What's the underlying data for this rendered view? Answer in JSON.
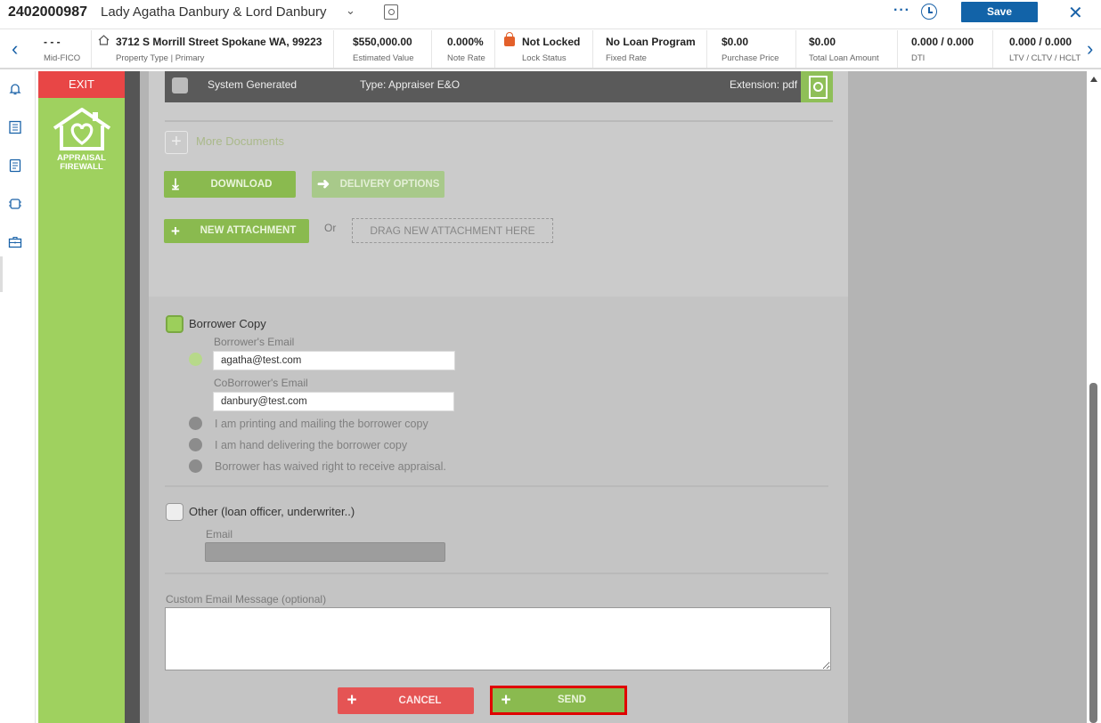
{
  "header": {
    "loan_number": "2402000987",
    "borrower_names": "Lady Agatha Danbury & Lord Danbury",
    "save_label": "Save",
    "more_label": "···",
    "close_glyph": "✕",
    "accent_color": "#1263a8"
  },
  "infobar": {
    "prev_glyph": "‹",
    "next_glyph": "›",
    "fields": [
      {
        "value": "- - -",
        "label": "Mid-FICO"
      },
      {
        "value": "3712 S Morrill Street Spokane WA, 99223",
        "label": "Property Type | Primary"
      },
      {
        "value": "$550,000.00",
        "label": "Estimated Value"
      },
      {
        "value": "0.000%",
        "label": "Note Rate"
      },
      {
        "value": "Not Locked",
        "label": "Lock Status"
      },
      {
        "value": "No Loan Program",
        "label": "Fixed Rate"
      },
      {
        "value": "$0.00",
        "label": "Purchase Price"
      },
      {
        "value": "$0.00",
        "label": "Total Loan Amount"
      },
      {
        "value": "0.000 / 0.000",
        "label": "DTI"
      },
      {
        "value": "0.000 / 0.000",
        "label": "LTV / CLTV / HCLT"
      }
    ]
  },
  "firewall": {
    "exit_label": "EXIT",
    "logo_text_1": "APPRAISAL",
    "logo_text_2": "FIREWALL",
    "panel_color": "#9fd15f",
    "exit_color": "#e84646"
  },
  "document": {
    "source": "System Generated",
    "type": "Type: Appraiser E&O",
    "extension": "Extension: pdf"
  },
  "actions": {
    "more_documents": "More Documents",
    "download": "DOWNLOAD",
    "delivery_options": "DELIVERY OPTIONS",
    "new_attachment": "NEW ATTACHMENT",
    "or": "Or",
    "drag_here": "DRAG NEW ATTACHMENT HERE"
  },
  "recipients": {
    "borrower_copy_label": "Borrower Copy",
    "borrower_copy_checked": true,
    "borrower_email_label": "Borrower's Email",
    "borrower_email": "agatha@test.com",
    "coborrower_email_label": "CoBorrower's Email",
    "coborrower_email": "danbury@test.com",
    "options": [
      "I am printing and mailing the borrower copy",
      "I am hand delivering the borrower copy",
      "Borrower has waived right to receive appraisal."
    ],
    "other_label": "Other (loan officer, underwriter..)",
    "other_checked": false,
    "email_label": "Email",
    "custom_message_label": "Custom Email Message (optional)"
  },
  "footer": {
    "cancel": "CANCEL",
    "send": "SEND",
    "highlight_color": "#e00000"
  }
}
